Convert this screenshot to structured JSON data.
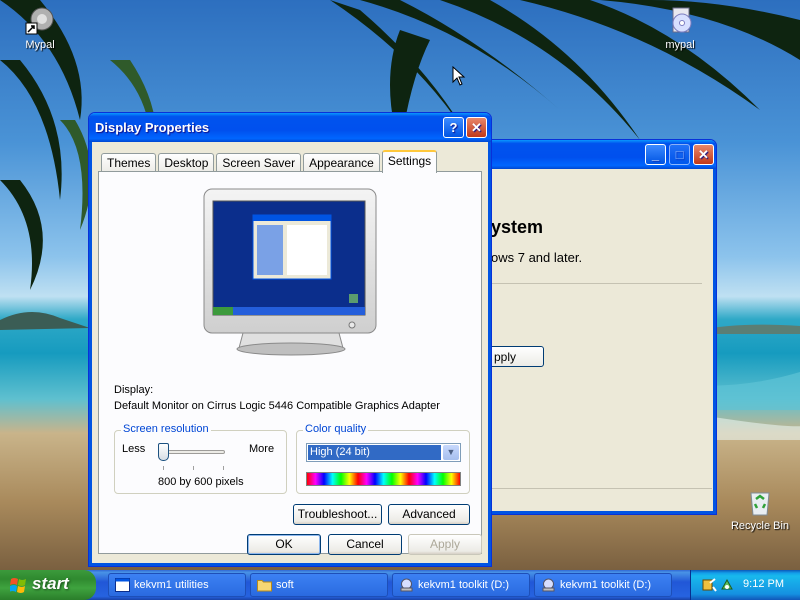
{
  "desktop": {
    "icons": [
      {
        "label": "Mypal",
        "icon": "mypal-shortcut-icon"
      },
      {
        "label": "mypal",
        "icon": "mypal-cd-icon"
      },
      {
        "label": "Recycle Bin",
        "icon": "recycle-bin-icon"
      }
    ]
  },
  "background_window": {
    "heading": "ystem",
    "text": "ows 7 and later.",
    "apply_label": "pply",
    "controls": [
      "minimize",
      "maximize",
      "close"
    ]
  },
  "dialog": {
    "title": "Display Properties",
    "help_glyph": "?",
    "tabs": [
      {
        "label": "Themes",
        "active": false
      },
      {
        "label": "Desktop",
        "active": false
      },
      {
        "label": "Screen Saver",
        "active": false
      },
      {
        "label": "Appearance",
        "active": false
      },
      {
        "label": "Settings",
        "active": true
      }
    ],
    "display_label": "Display:",
    "display_value": "Default Monitor on Cirrus Logic 5446 Compatible Graphics Adapter",
    "resolution": {
      "legend": "Screen resolution",
      "less_label": "Less",
      "more_label": "More",
      "value_text": "800 by 600 pixels",
      "slider_position": 0
    },
    "color_quality": {
      "legend": "Color quality",
      "selected": "High (24 bit)"
    },
    "troubleshoot_label": "Troubleshoot...",
    "advanced_label": "Advanced",
    "ok_label": "OK",
    "cancel_label": "Cancel",
    "apply_label": "Apply"
  },
  "taskbar": {
    "start_label": "start",
    "tasks": [
      {
        "label": "kekvm1 utilities",
        "icon": "window-icon"
      },
      {
        "label": "soft",
        "icon": "folder-icon"
      },
      {
        "label": "kekvm1 toolkit (D:)",
        "icon": "cd-drive-icon"
      },
      {
        "label": "kekvm1 toolkit (D:)",
        "icon": "cd-drive-icon"
      }
    ],
    "clock": "9:12 PM"
  },
  "colors": {
    "title_blue": "#0054e3",
    "dialog_face": "#ece9d8",
    "start_green": "#3c9a3c",
    "selection_blue": "#316ac5"
  }
}
